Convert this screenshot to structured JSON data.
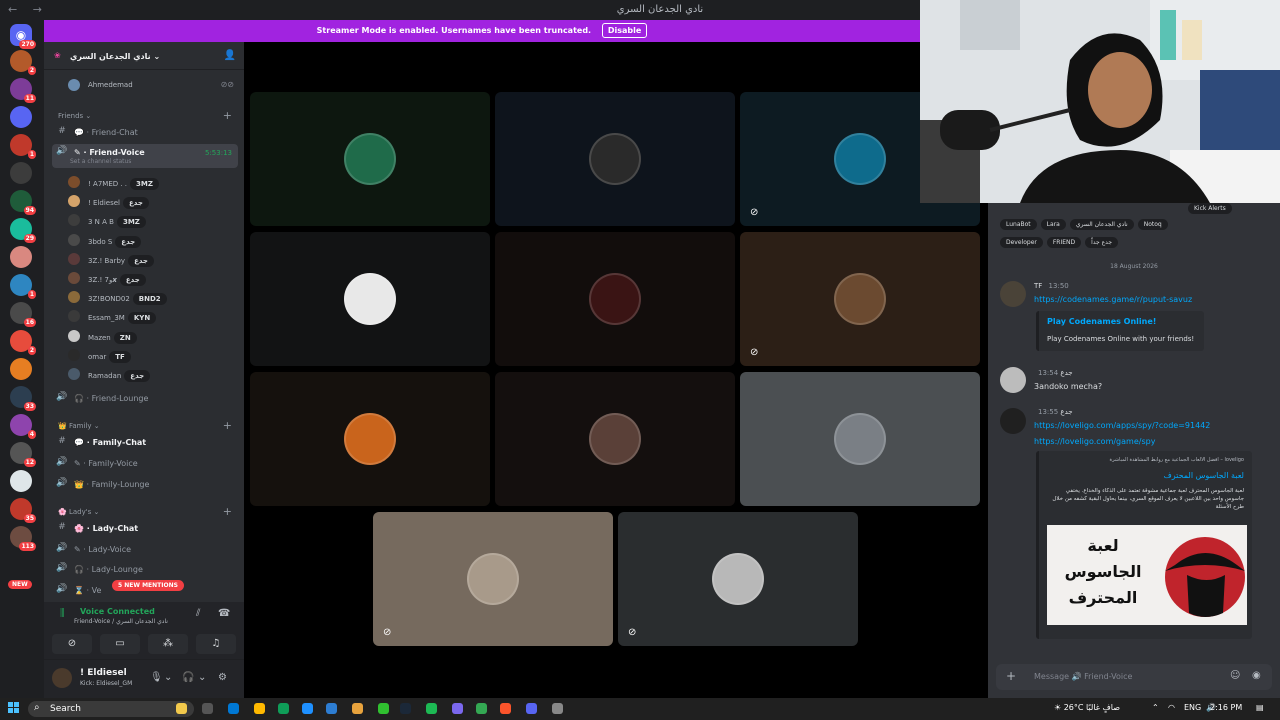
{
  "window": {
    "title": "نادي الجدعان السري"
  },
  "rail": {
    "home_badge": "270",
    "new_label": "NEW",
    "servers": [
      {
        "badge": "2",
        "color": "#b35a2a"
      },
      {
        "badge": "11",
        "color": "#7d3c98"
      },
      {
        "badge": "",
        "color": "#5865f2"
      },
      {
        "badge": "1",
        "color": "#c0392b"
      },
      {
        "badge": "",
        "color": "#3c3c3c"
      },
      {
        "badge": "94",
        "color": "#1f5c3a"
      },
      {
        "badge": "29",
        "color": "#1abc9c"
      },
      {
        "badge": "",
        "color": "#d98880"
      },
      {
        "badge": "1",
        "color": "#2e86c1"
      },
      {
        "badge": "16",
        "color": "#4a4a4a"
      },
      {
        "badge": "2",
        "color": "#e74c3c"
      },
      {
        "badge": "",
        "color": "#e67e22"
      },
      {
        "badge": "33",
        "color": "#2c3e50"
      },
      {
        "badge": "4",
        "color": "#8e44ad"
      },
      {
        "badge": "12",
        "color": "#555555"
      },
      {
        "badge": "",
        "color": "#dfe6e9"
      },
      {
        "badge": "35",
        "color": "#c0392b"
      },
      {
        "badge": "113",
        "color": "#6d4c41"
      }
    ]
  },
  "banner": {
    "text": "Streamer Mode is enabled. Usernames have been truncated.",
    "button": "Disable"
  },
  "sidebar": {
    "guild_name": "نادي الجدعان السري",
    "top_user": "Ahmedemad",
    "friends_category": "Friends",
    "family_category": "Family",
    "ladys_category": "Lady's",
    "channels": {
      "friend_chat": "Friend-Chat",
      "friend_voice": "Friend-Voice",
      "friend_voice_time": "5:53:13",
      "friend_voice_status": "Set a channel status",
      "friend_lounge": "Friend-Lounge",
      "family_chat": "Family-Chat",
      "family_voice": "Family-Voice",
      "family_lounge": "Family-Lounge",
      "lady_chat": "Lady-Chat",
      "lady_voice": "Lady-Voice",
      "lady_lounge": "Lady-Lounge",
      "ve_partial": "Ve"
    },
    "members": [
      {
        "name": "! A7MED . .",
        "tag": "3MZ"
      },
      {
        "name": "! Eldiesel",
        "tag": "جدع"
      },
      {
        "name": "3 N A B",
        "tag": "3MZ"
      },
      {
        "name": "3bdo S",
        "tag": "جدع"
      },
      {
        "name": "3Z.! Barby",
        "tag": "جدع"
      },
      {
        "name": "3Z.! 7و𝙭",
        "tag": "جدع"
      },
      {
        "name": "3Z!BOND02",
        "tag": "BND2"
      },
      {
        "name": "Essam_3M",
        "tag": "KYN"
      },
      {
        "name": "Mazen",
        "tag": "ZN"
      },
      {
        "name": "omar",
        "tag": "TF"
      },
      {
        "name": "Ramadan",
        "tag": "جدع"
      }
    ],
    "mentions_badge": "5 NEW MENTIONS"
  },
  "voice_panel": {
    "status": "Voice Connected",
    "location": "Friend-Voice / نادي الجدعان السري"
  },
  "user": {
    "name": "! Eldiesel",
    "status": "Kick: Eldiesel_GM"
  },
  "stage": {
    "tiles": [
      {
        "bg": "#0d170f",
        "avatar_color": "#1f6b4a",
        "muted": false
      },
      {
        "bg": "#0e141c",
        "avatar_color": "#2a2a2a",
        "muted": false
      },
      {
        "bg": "#0d1b22",
        "avatar_color": "#0e6b8c",
        "muted": true
      },
      {
        "bg": "#121314",
        "avatar_color": "#e8e8e8",
        "muted": false
      },
      {
        "bg": "#120d0c",
        "avatar_color": "#3a1414",
        "muted": false
      },
      {
        "bg": "#2c1f16",
        "avatar_color": "#6b4a30",
        "muted": true
      },
      {
        "bg": "#15110d",
        "avatar_color": "#c9641c",
        "muted": false
      },
      {
        "bg": "#140f0e",
        "avatar_color": "#5a4038",
        "muted": false
      },
      {
        "bg": "#4b4f52",
        "avatar_color": "#7a7f85",
        "muted": false
      },
      {
        "bg": "#766a5e",
        "avatar_color": "#a89a8a",
        "muted": true
      },
      {
        "bg": "#2a2d2f",
        "avatar_color": "#b8b8b8",
        "muted": true
      }
    ]
  },
  "chat": {
    "tags_row1": [
      "Kick Alerts"
    ],
    "tags_row2": [
      "LunaBot",
      "Lara",
      "نادي الجدعان السري",
      "Notoq"
    ],
    "tags_row3": [
      "Developer",
      "FRIEND",
      "جدع جداً"
    ],
    "date_divider": "18 August 2026",
    "messages": [
      {
        "badge": "TF",
        "time": "13:50",
        "link": "https://codenames.game/r/puput-savuz",
        "embed_title": "Play Codenames Online!",
        "embed_desc": "Play Codenames Online with your friends!"
      },
      {
        "badge": "جدع",
        "time": "13:54",
        "text": "3andoko mecha?"
      },
      {
        "badge": "جدع",
        "time": "13:55",
        "link1": "https://loveligo.com/apps/spy/?code=91442",
        "link2": "https://loveligo.com/game/spy",
        "embed_provider": "loveligo – أفضل الألعاب الجماعية مع روابط المشاهدة المباشرة",
        "embed_title": "لعبة الجاسوس المحترف",
        "embed_desc": "لعبة الجاسوس المحترف لعبة جماعية مشوقة تعتمد على الذكاء والخداع. يختفي جاسوس واحد بين اللاعبين لا يعرف الموقع السري، بينما يحاول البقية كشفه من خلال طرح الأسئلة",
        "image_text": "لعبة الجاسوس المحترف"
      }
    ],
    "input_placeholder": "Message 🔊 Friend-Voice"
  },
  "taskbar": {
    "search": "Search",
    "weather": "26°C صافٍ غالبًا",
    "lang": "ENG",
    "time": "2:16 PM"
  }
}
